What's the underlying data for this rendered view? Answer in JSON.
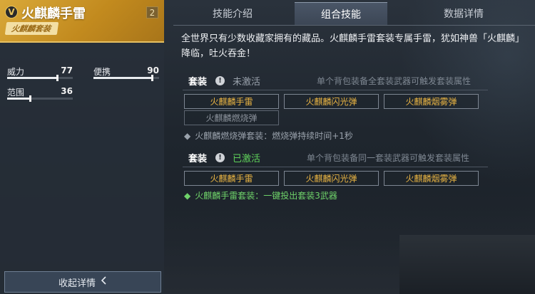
{
  "item": {
    "rank": "V",
    "name": "火麒麟手雷",
    "count": "2",
    "set_tag": "火麒麟套装"
  },
  "stats": [
    {
      "label": "威力",
      "value": "77",
      "level": 0.77
    },
    {
      "label": "便携",
      "value": "90",
      "level": 0.9
    },
    {
      "label": "范围",
      "value": "36",
      "level": 0.36
    }
  ],
  "collapse": {
    "label": "收起详情",
    "icon": "chevron-left-icon"
  },
  "tabs": [
    {
      "label": "技能介绍",
      "active": false
    },
    {
      "label": "组合技能",
      "active": true
    },
    {
      "label": "数据详情",
      "active": false
    }
  ],
  "description": "全世界只有少数收藏家拥有的藏品。火麒麟手雷套装专属手雷，犹如神兽「火麒麟」降临，吐火吞金！",
  "sets": [
    {
      "label": "套装",
      "warn_icon": "!",
      "status": "未激活",
      "status_color": "#9aa2ac",
      "hint": "单个背包装备全套装武器可触发套装属性",
      "weapons": [
        {
          "name": "火麒麟手雷",
          "dim": false
        },
        {
          "name": "火麒麟闪光弹",
          "dim": false
        },
        {
          "name": "火麒麟烟雾弹",
          "dim": false
        },
        {
          "name": "火麒麟燃烧弹",
          "dim": true
        }
      ],
      "effect_bullet": "◆",
      "effect": "火麒麟燃烧弹套装：燃烧弹持续时间+1秒",
      "effect_color": "#9aa2ac"
    },
    {
      "label": "套装",
      "warn_icon": "!",
      "status": "已激活",
      "status_color": "#5fd35a",
      "hint": "单个背包装备同一套装武器可触发套装属性",
      "weapons": [
        {
          "name": "火麒麟手雷",
          "dim": false
        },
        {
          "name": "火麒麟闪光弹",
          "dim": false
        },
        {
          "name": "火麒麟烟雾弹",
          "dim": false
        }
      ],
      "effect_bullet": "◆",
      "effect": "火麒麟手雷套装：一键投出套装3武器",
      "effect_color": "#6fd36a"
    }
  ],
  "colors": {
    "accent_gold": "#d9a93a",
    "weapon_text": "#e9b443",
    "active_green": "#5fd35a"
  }
}
